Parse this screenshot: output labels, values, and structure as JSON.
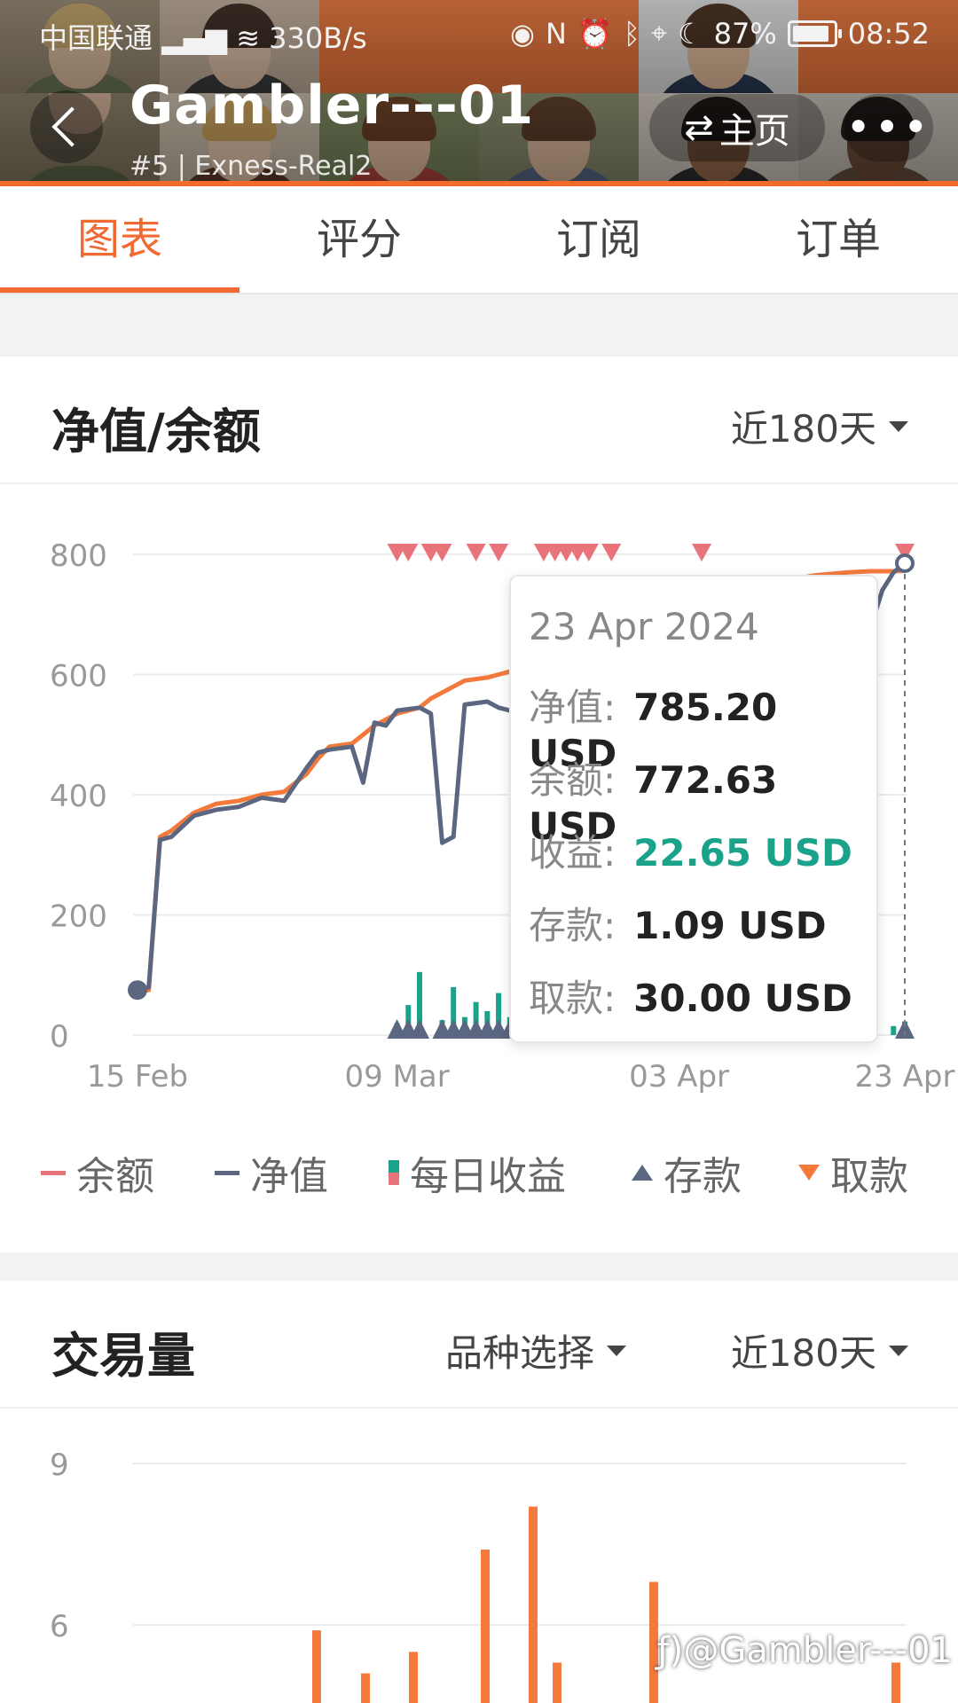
{
  "status_bar": {
    "carrier": "中国联通",
    "speed": "330B/s",
    "battery": "87%",
    "time": "08:52"
  },
  "header": {
    "title": "Gambler---01",
    "subtitle": "#5 | Exness-Real2",
    "home_label": "主页",
    "more_label": "•••",
    "accent_color": "#f26a33"
  },
  "tabs": [
    {
      "label": "图表",
      "active": true
    },
    {
      "label": "评分",
      "active": false
    },
    {
      "label": "订阅",
      "active": false
    },
    {
      "label": "订单",
      "active": false
    }
  ],
  "equity_card": {
    "title": "净值/余额",
    "range_label": "近180天",
    "tooltip": {
      "date": "23 Apr 2024",
      "rows": [
        {
          "key": "净值:",
          "value": "785.20 USD"
        },
        {
          "key": "余额:",
          "value": "772.63 USD"
        },
        {
          "key": "收益:",
          "value": "22.65 USD"
        },
        {
          "key": "存款:",
          "value": "1.09 USD"
        },
        {
          "key": "取款:",
          "value": "30.00 USD"
        }
      ]
    },
    "legend": [
      {
        "label": "余额",
        "color": "#e8737a"
      },
      {
        "label": "净值",
        "color": "#5b6780"
      },
      {
        "label": "每日收益",
        "color": "#1aa38a"
      },
      {
        "label": "存款",
        "color": "#5b6780"
      },
      {
        "label": "取款",
        "color": "#f47a3c"
      }
    ]
  },
  "volume_card": {
    "title": "交易量",
    "symbol_label": "品种选择",
    "range_label": "近180天"
  },
  "chart_data": [
    {
      "type": "line",
      "x_ticks": [
        "15 Feb",
        "09 Mar",
        "03 Apr",
        "23 Apr"
      ],
      "y_ticks": [
        "0",
        "200",
        "400",
        "600",
        "800"
      ],
      "ylim": [
        0,
        800
      ],
      "x": [
        "15 Feb",
        "16 Feb",
        "17 Feb",
        "18 Feb",
        "20 Feb",
        "22 Feb",
        "24 Feb",
        "26 Feb",
        "28 Feb",
        "01 Mar",
        "02 Mar",
        "03 Mar",
        "05 Mar",
        "06 Mar",
        "07 Mar",
        "08 Mar",
        "09 Mar",
        "11 Mar",
        "12 Mar",
        "13 Mar",
        "14 Mar",
        "15 Mar",
        "17 Mar",
        "18 Mar",
        "19 Mar",
        "20 Mar",
        "22 Mar",
        "24 Mar",
        "26 Mar",
        "29 Mar",
        "01 Apr",
        "03 Apr",
        "06 Apr",
        "09 Apr",
        "12 Apr",
        "15 Apr",
        "18 Apr",
        "20 Apr",
        "21 Apr",
        "22 Apr",
        "23 Apr"
      ],
      "series": [
        {
          "name": "余额",
          "color": "#f47a3c",
          "values": [
            75,
            75,
            330,
            340,
            370,
            385,
            390,
            400,
            405,
            435,
            460,
            480,
            485,
            500,
            515,
            525,
            535,
            545,
            560,
            570,
            580,
            590,
            595,
            600,
            605,
            610,
            620,
            630,
            640,
            660,
            690,
            710,
            730,
            745,
            755,
            765,
            770,
            772,
            772,
            772,
            772.63
          ]
        },
        {
          "name": "净值",
          "color": "#5b6780",
          "values": [
            75,
            80,
            325,
            330,
            365,
            375,
            380,
            395,
            390,
            445,
            470,
            475,
            480,
            420,
            520,
            515,
            540,
            545,
            535,
            320,
            330,
            550,
            555,
            545,
            540,
            560,
            570,
            590,
            600,
            640,
            670,
            690,
            720,
            740,
            750,
            760,
            760,
            680,
            740,
            770,
            785.2
          ]
        },
        {
          "name": "每日收益",
          "color": "#1aa38a",
          "bars": [
            {
              "x": "09 Mar",
              "value": 20
            },
            {
              "x": "10 Mar",
              "value": 50
            },
            {
              "x": "11 Mar",
              "value": 105
            },
            {
              "x": "13 Mar",
              "value": 25
            },
            {
              "x": "14 Mar",
              "value": 80
            },
            {
              "x": "15 Mar",
              "value": 30
            },
            {
              "x": "16 Mar",
              "value": 55
            },
            {
              "x": "17 Mar",
              "value": 40
            },
            {
              "x": "18 Mar",
              "value": 70
            },
            {
              "x": "19 Mar",
              "value": 30
            },
            {
              "x": "20 Mar",
              "value": 85
            },
            {
              "x": "21 Mar",
              "value": 60
            },
            {
              "x": "22 Apr",
              "value": 15
            },
            {
              "x": "23 Apr",
              "value": 22.65
            }
          ]
        }
      ],
      "deposit_markers": [
        "09 Mar",
        "10 Mar",
        "11 Mar",
        "13 Mar",
        "14 Mar",
        "15 Mar",
        "16 Mar",
        "17 Mar",
        "18 Mar",
        "19 Mar",
        "22 Mar",
        "23 Apr"
      ],
      "withdrawal_markers": [
        "09 Mar",
        "10 Mar",
        "12 Mar",
        "13 Mar",
        "16 Mar",
        "18 Mar",
        "22 Mar",
        "23 Mar",
        "24 Mar",
        "25 Mar",
        "26 Mar",
        "28 Mar",
        "05 Apr",
        "23 Apr"
      ]
    },
    {
      "type": "bar",
      "y_ticks": [
        "6",
        "9"
      ],
      "values": [
        5.9,
        5.1,
        5.5,
        7.4,
        8.2,
        5.3,
        6.8,
        5.3
      ],
      "color": "#f47a3c"
    }
  ],
  "watermark": "@Gambler---01"
}
